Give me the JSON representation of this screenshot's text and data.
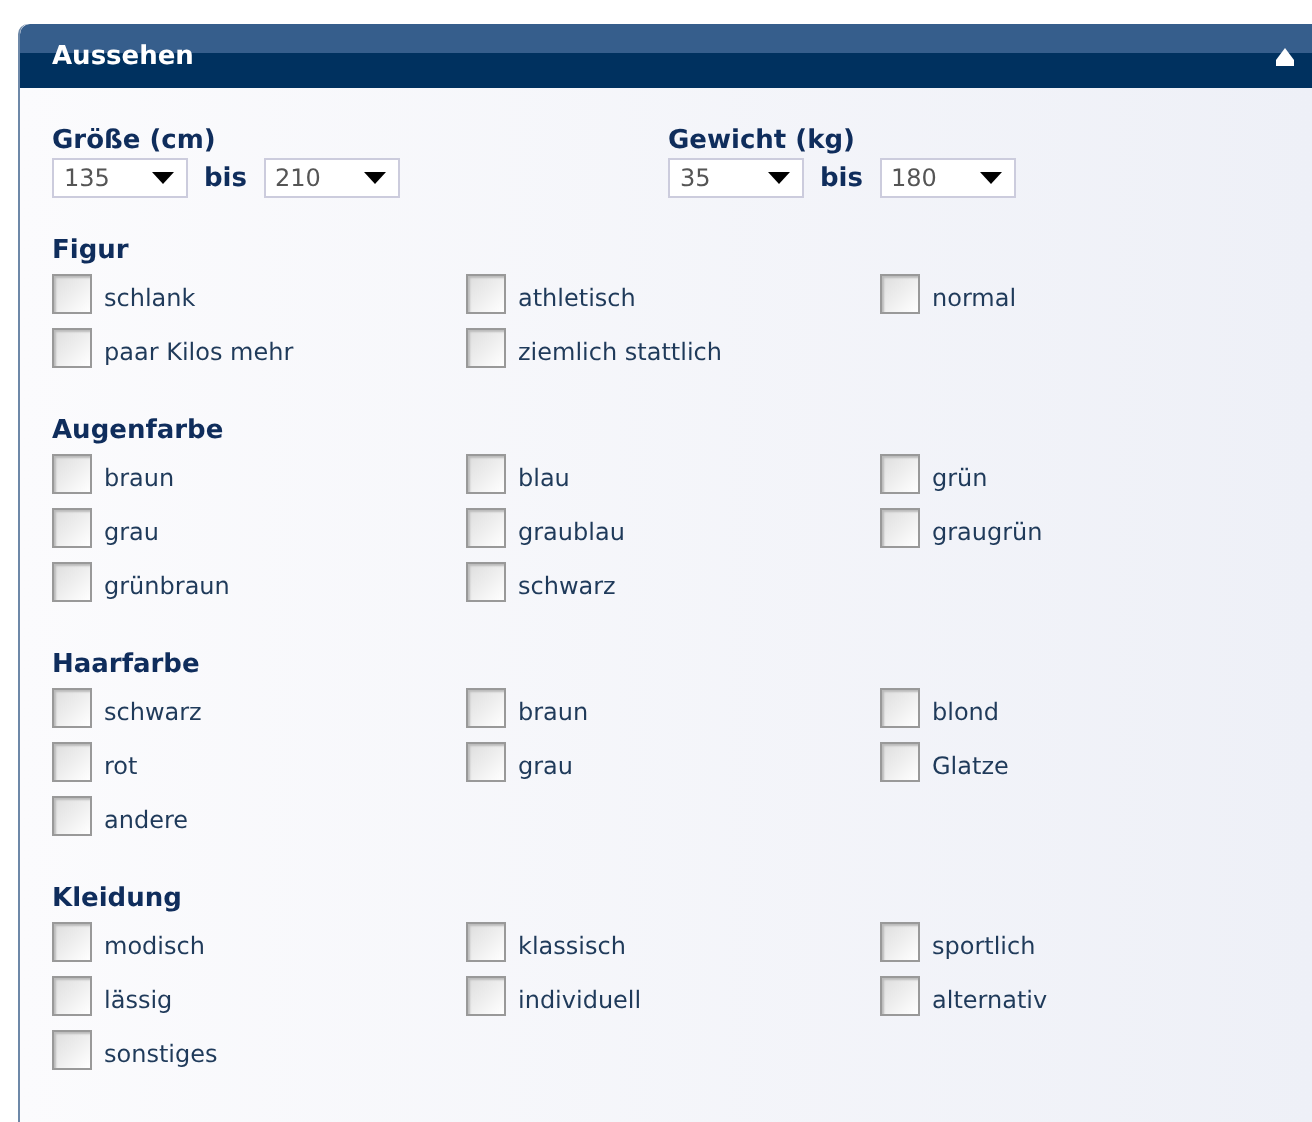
{
  "panel": {
    "title": "Aussehen",
    "expanded": true
  },
  "ranges": [
    {
      "label": "Größe (cm)",
      "from": "135",
      "separator": "bis",
      "to": "210"
    },
    {
      "label": "Gewicht (kg)",
      "from": "35",
      "separator": "bis",
      "to": "180"
    }
  ],
  "groups": [
    {
      "title": "Figur",
      "options": [
        {
          "label": "schlank",
          "checked": false
        },
        {
          "label": "athletisch",
          "checked": false
        },
        {
          "label": "normal",
          "checked": false
        },
        {
          "label": "paar Kilos mehr",
          "checked": false
        },
        {
          "label": "ziemlich stattlich",
          "checked": false
        }
      ]
    },
    {
      "title": "Augenfarbe",
      "options": [
        {
          "label": "braun",
          "checked": false
        },
        {
          "label": "blau",
          "checked": false
        },
        {
          "label": "grün",
          "checked": false
        },
        {
          "label": "grau",
          "checked": false
        },
        {
          "label": "graublau",
          "checked": false
        },
        {
          "label": "graugrün",
          "checked": false
        },
        {
          "label": "grünbraun",
          "checked": false
        },
        {
          "label": "schwarz",
          "checked": false
        }
      ]
    },
    {
      "title": "Haarfarbe",
      "options": [
        {
          "label": "schwarz",
          "checked": false
        },
        {
          "label": "braun",
          "checked": false
        },
        {
          "label": "blond",
          "checked": false
        },
        {
          "label": "rot",
          "checked": false
        },
        {
          "label": "grau",
          "checked": false
        },
        {
          "label": "Glatze",
          "checked": false
        },
        {
          "label": "andere",
          "checked": false
        }
      ]
    },
    {
      "title": "Kleidung",
      "options": [
        {
          "label": "modisch",
          "checked": false
        },
        {
          "label": "klassisch",
          "checked": false
        },
        {
          "label": "sportlich",
          "checked": false
        },
        {
          "label": "lässig",
          "checked": false
        },
        {
          "label": "individuell",
          "checked": false
        },
        {
          "label": "alternativ",
          "checked": false
        },
        {
          "label": "sonstiges",
          "checked": false
        }
      ]
    }
  ]
}
